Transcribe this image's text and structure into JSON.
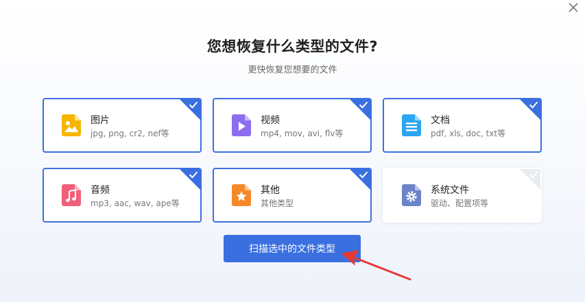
{
  "dialog": {
    "title": "您想恢复什么类型的文件?",
    "subtitle": "更快恢复您想要的文件",
    "close_icon": "close-icon"
  },
  "categories": [
    {
      "name": "图片",
      "desc": "jpg, png, cr2, nef等",
      "selected": true,
      "icon": "image-icon",
      "color": "#f7b500"
    },
    {
      "name": "视频",
      "desc": "mp4, mov, avi, flv等",
      "selected": true,
      "icon": "video-icon",
      "color": "#8c6df0"
    },
    {
      "name": "文档",
      "desc": "pdf, xls, doc, txt等",
      "selected": true,
      "icon": "document-icon",
      "color": "#2aa6f0"
    },
    {
      "name": "音频",
      "desc": "mp3, aac, wav, ape等",
      "selected": true,
      "icon": "music-icon",
      "color": "#f0607a"
    },
    {
      "name": "其他",
      "desc": "其他类型",
      "selected": true,
      "icon": "star-icon",
      "color": "#f5892a"
    },
    {
      "name": "系统文件",
      "desc": "驱动、配置项等",
      "selected": false,
      "icon": "gear-icon",
      "color": "#6b84c8"
    }
  ],
  "scan_button": {
    "label": "扫描选中的文件类型"
  },
  "colors": {
    "accent": "#3a6fe0",
    "annotation_arrow": "#e53935"
  }
}
